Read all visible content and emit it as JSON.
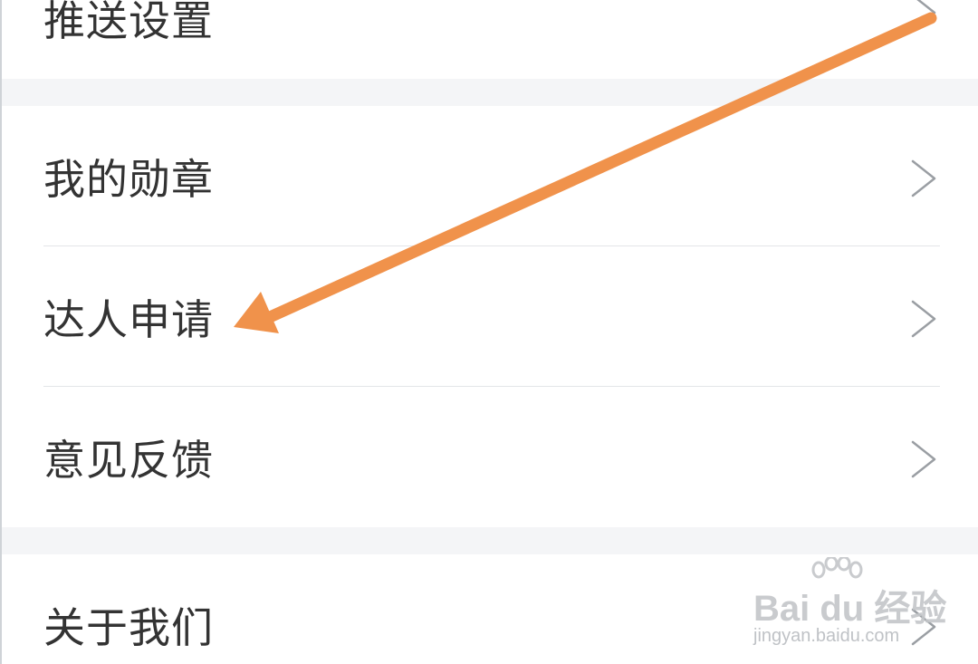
{
  "menu": {
    "items": [
      {
        "label": "推送设置"
      },
      {
        "label": "我的勋章"
      },
      {
        "label": "达人申请"
      },
      {
        "label": "意见反馈"
      },
      {
        "label": "关于我们"
      }
    ]
  },
  "annotation": {
    "arrow_color": "#f0924b",
    "points_to": "达人申请"
  },
  "watermark": {
    "brand": "Bai du 经验",
    "url": "jingyan.baidu.com"
  },
  "colors": {
    "text": "#333333",
    "divider": "#e3e5e8",
    "section_gap": "#f4f5f7",
    "chevron": "#9a9ea3"
  }
}
